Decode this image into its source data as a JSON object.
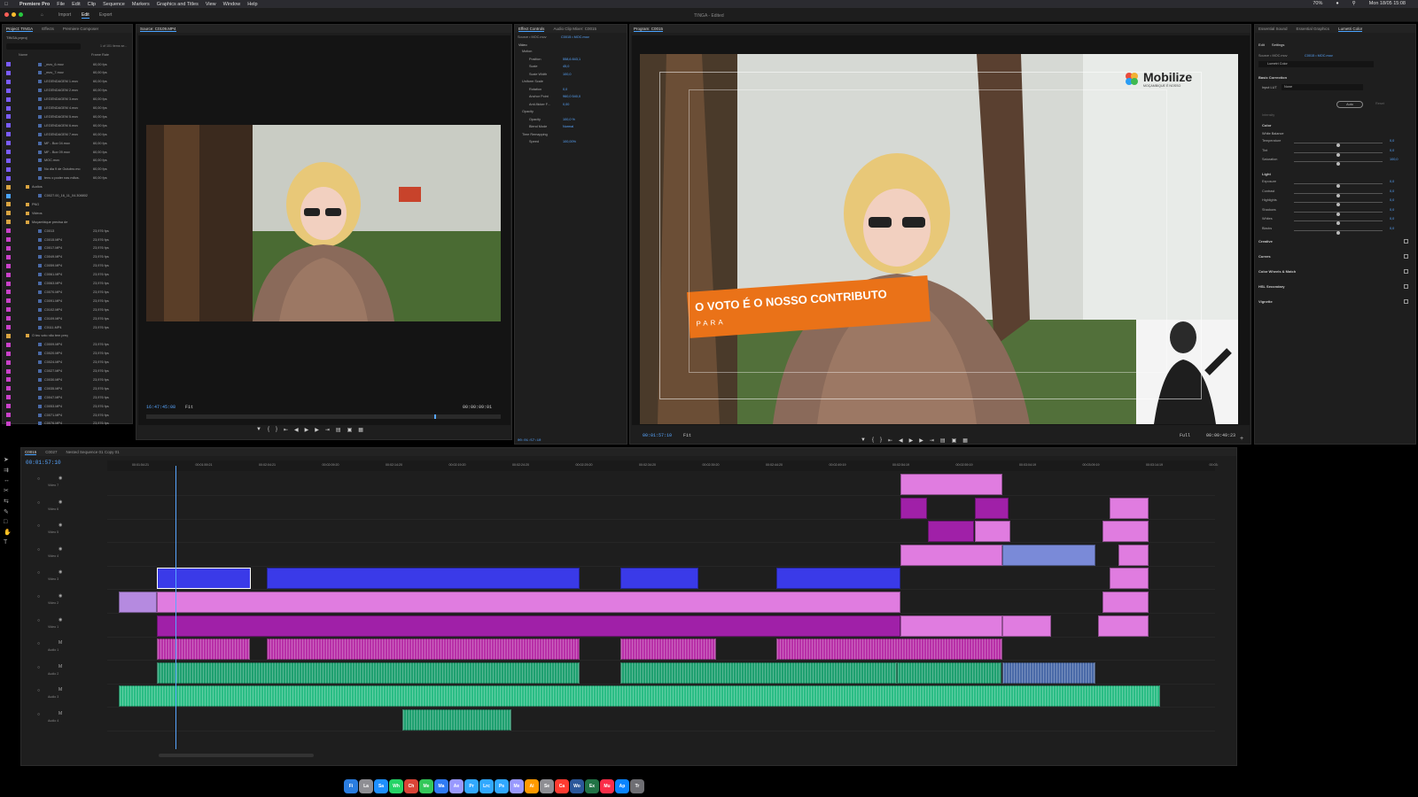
{
  "menubar": {
    "app_name": "Premiere Pro",
    "items": [
      "File",
      "Edit",
      "Clip",
      "Sequence",
      "Markers",
      "Graphics and Titles",
      "View",
      "Window",
      "Help"
    ],
    "battery": "70%",
    "datetime": "Mon 18/05  15:08"
  },
  "workspace": {
    "tabs": [
      "Import",
      "Edit",
      "Export"
    ],
    "active_tab": "Edit",
    "doc_title": "TINGA - Edited"
  },
  "project_panel": {
    "tabs": [
      "Project: TINGA",
      "Effects",
      "Premiere Composer"
    ],
    "project_file": "TINGA.prproj",
    "item_count": "1 of 101 items se...",
    "col_name": "Name",
    "col_fps": "Frame Rate",
    "items": [
      {
        "name": "_mov_6.mov",
        "fps": "60,00 fps",
        "color": "#7a5cff",
        "type": "clip"
      },
      {
        "name": "_mov_7.mov",
        "fps": "60,00 fps",
        "color": "#7a5cff",
        "type": "clip"
      },
      {
        "name": "LEGENDAGEM 1.mov",
        "fps": "60,00 fps",
        "color": "#7a5cff",
        "type": "clip"
      },
      {
        "name": "LEGENDAGEM 2.mov",
        "fps": "60,00 fps",
        "color": "#7a5cff",
        "type": "clip"
      },
      {
        "name": "LEGENDAGEM 3.mov",
        "fps": "60,00 fps",
        "color": "#7a5cff",
        "type": "clip"
      },
      {
        "name": "LEGENDAGEM 4.mov",
        "fps": "60,00 fps",
        "color": "#7a5cff",
        "type": "clip"
      },
      {
        "name": "LEGENDAGEM 5.mov",
        "fps": "60,00 fps",
        "color": "#7a5cff",
        "type": "clip"
      },
      {
        "name": "LEGENDAGEM 6.mov",
        "fps": "60,00 fps",
        "color": "#7a5cff",
        "type": "clip"
      },
      {
        "name": "LEGENDAGEM 7.mov",
        "fps": "60,00 fps",
        "color": "#7a5cff",
        "type": "clip"
      },
      {
        "name": "MF - Box 04.mov",
        "fps": "60,00 fps",
        "color": "#7a5cff",
        "type": "clip"
      },
      {
        "name": "MF - Box 09.mov",
        "fps": "60,00 fps",
        "color": "#7a5cff",
        "type": "clip"
      },
      {
        "name": "MOC.mov",
        "fps": "60,00 fps",
        "color": "#7a5cff",
        "type": "clip"
      },
      {
        "name": "No dia 9 de Outubro.mo",
        "fps": "60,00 fps",
        "color": "#7a5cff",
        "type": "clip"
      },
      {
        "name": "tens o poder nas mãos.",
        "fps": "60,00 fps",
        "color": "#7a5cff",
        "type": "clip"
      },
      {
        "name": "Audios",
        "fps": "",
        "color": "#d9a441",
        "type": "bin"
      },
      {
        "name": "C0027.00_16_11_04.308802",
        "fps": "",
        "color": "#4aa3ff",
        "type": "clip"
      },
      {
        "name": "PNG",
        "fps": "",
        "color": "#d9a441",
        "type": "bin"
      },
      {
        "name": "Videos",
        "fps": "",
        "color": "#d9a441",
        "type": "bin"
      },
      {
        "name": "Moçambique precisa de",
        "fps": "",
        "color": "#d9a441",
        "type": "bin"
      },
      {
        "name": "C0013",
        "fps": "23,976 fps",
        "color": "#c941c9",
        "type": "clip"
      },
      {
        "name": "C0015.MP4",
        "fps": "23,976 fps",
        "color": "#c941c9",
        "type": "clip"
      },
      {
        "name": "C0017.MP4",
        "fps": "23,976 fps",
        "color": "#c941c9",
        "type": "clip"
      },
      {
        "name": "C0049.MP4",
        "fps": "23,976 fps",
        "color": "#c941c9",
        "type": "clip"
      },
      {
        "name": "C0059.MP4",
        "fps": "23,976 fps",
        "color": "#c941c9",
        "type": "clip"
      },
      {
        "name": "C0061.MP4",
        "fps": "23,976 fps",
        "color": "#c941c9",
        "type": "clip"
      },
      {
        "name": "C0063.MP4",
        "fps": "23,976 fps",
        "color": "#c941c9",
        "type": "clip"
      },
      {
        "name": "C0070.MP4",
        "fps": "23,976 fps",
        "color": "#c941c9",
        "type": "clip"
      },
      {
        "name": "C0091.MP4",
        "fps": "23,976 fps",
        "color": "#c941c9",
        "type": "clip"
      },
      {
        "name": "C0102.MP4",
        "fps": "23,976 fps",
        "color": "#c941c9",
        "type": "clip"
      },
      {
        "name": "C0109.MP4",
        "fps": "23,976 fps",
        "color": "#c941c9",
        "type": "clip"
      },
      {
        "name": "C0111.MP4",
        "fps": "23,976 fps",
        "color": "#c941c9",
        "type": "clip"
      },
      {
        "name": "O teu voto não tem preç",
        "fps": "",
        "color": "#d9a441",
        "type": "bin"
      },
      {
        "name": "C0009.MP4",
        "fps": "23,976 fps",
        "color": "#c941c9",
        "type": "clip"
      },
      {
        "name": "C0020.MP4",
        "fps": "23,976 fps",
        "color": "#c941c9",
        "type": "clip"
      },
      {
        "name": "C0024.MP4",
        "fps": "23,976 fps",
        "color": "#c941c9",
        "type": "clip"
      },
      {
        "name": "C0027.MP4",
        "fps": "23,976 fps",
        "color": "#c941c9",
        "type": "clip"
      },
      {
        "name": "C0030.MP4",
        "fps": "23,976 fps",
        "color": "#c941c9",
        "type": "clip"
      },
      {
        "name": "C0035.MP4",
        "fps": "23,976 fps",
        "color": "#c941c9",
        "type": "clip"
      },
      {
        "name": "C0047.MP4",
        "fps": "23,976 fps",
        "color": "#c941c9",
        "type": "clip"
      },
      {
        "name": "C0053.MP4",
        "fps": "23,976 fps",
        "color": "#c941c9",
        "type": "clip"
      },
      {
        "name": "C0071.MP4",
        "fps": "23,976 fps",
        "color": "#c941c9",
        "type": "clip"
      },
      {
        "name": "C0076.MP4",
        "fps": "23,976 fps",
        "color": "#c941c9",
        "type": "clip"
      }
    ]
  },
  "source_monitor": {
    "tab": "Source: C0109.MP4",
    "timecode": "16:47:45:08",
    "fit": "Fit",
    "duration": "00:00:09:01"
  },
  "effect_controls": {
    "tabs": [
      "Effect Controls",
      "Audio Clip Mixer: C0015"
    ],
    "source": "Source • MOC.mov",
    "seq": "C0015 • MOC.mov",
    "section_video": "Video",
    "rows": [
      {
        "label": "Motion",
        "value": ""
      },
      {
        "label": "Position",
        "value": "558,6   843,1"
      },
      {
        "label": "Scale",
        "value": "45,0"
      },
      {
        "label": "Scale Width",
        "value": "100,0"
      },
      {
        "label": "Uniform Scale",
        "value": ""
      },
      {
        "label": "Rotation",
        "value": "0,0"
      },
      {
        "label": "Anchor Point",
        "value": "960,0   540,0"
      },
      {
        "label": "Anti-flicker F...",
        "value": "0,00"
      },
      {
        "label": "Opacity",
        "value": ""
      },
      {
        "label": "Opacity",
        "value": "100,0 %"
      },
      {
        "label": "Blend Mode",
        "value": "Normal"
      },
      {
        "label": "Time Remapping",
        "value": ""
      },
      {
        "label": "Speed",
        "value": "100,00%"
      }
    ],
    "timecode": "00:01:57:10"
  },
  "program_monitor": {
    "tab": "Program: C0015",
    "logo_text": "Mobilize",
    "logo_sub": "MOÇAMBIQUE É NOSSO",
    "lower_third_main": "O VOTO É O NOSSO CONTRIBUTO",
    "lower_third_sub": "PARA",
    "timecode": "00:01:57:10",
    "fit": "Fit",
    "full": "Full",
    "duration": "00:00:49:23"
  },
  "lumetri": {
    "tabs": [
      "Essential Sound",
      "Essential Graphics",
      "Lumetri Color"
    ],
    "subtabs": [
      "Edit",
      "Settings"
    ],
    "source": "Source • MOC.mov",
    "seq": "C0015 • MOC.mov",
    "effect": "Lumetri Color",
    "basic": "Basic Correction",
    "input_lut_label": "Input LUT",
    "input_lut": "None",
    "auto": "Auto",
    "reset": "Reset",
    "intensity": "Intensity",
    "color_label": "Color",
    "white_balance": "White Balance",
    "color_rows": [
      {
        "label": "Temperature",
        "value": "0,0",
        "pos": 0.5
      },
      {
        "label": "Tint",
        "value": "0,0",
        "pos": 0.5
      },
      {
        "label": "Saturation",
        "value": "100,0",
        "pos": 0.5
      }
    ],
    "light_label": "Light",
    "light_rows": [
      {
        "label": "Exposure",
        "value": "0,0",
        "pos": 0.5
      },
      {
        "label": "Contrast",
        "value": "0,0",
        "pos": 0.5
      },
      {
        "label": "Highlights",
        "value": "0,0",
        "pos": 0.5
      },
      {
        "label": "Shadows",
        "value": "0,0",
        "pos": 0.5
      },
      {
        "label": "Whites",
        "value": "0,0",
        "pos": 0.5
      },
      {
        "label": "Blacks",
        "value": "0,0",
        "pos": 0.5
      }
    ],
    "sections": [
      "Creative",
      "Curves",
      "Color Wheels & Match",
      "HSL Secondary",
      "Vignette"
    ]
  },
  "timeline": {
    "tabs": [
      "C0015",
      "C0027",
      "Nested Sequence 01 Copy 01"
    ],
    "timecode": "00:01:57:10",
    "ruler": [
      "00:01:54:21",
      "00:01:59:21",
      "00:02:04:21",
      "00:02:09:20",
      "00:02:14:20",
      "00:02:19:20",
      "00:02:24:20",
      "00:02:29:20",
      "00:02:34:20",
      "00:02:39:20",
      "00:02:44:20",
      "00:02:49:19",
      "00:02:54:19",
      "00:02:59:19",
      "00:03:04:19",
      "00:03:09:19",
      "00:03:14:19",
      "00:03:"
    ],
    "tracks": [
      "Video 7",
      "Video 6",
      "Video 5",
      "Video 4",
      "Video 3",
      "Video 2",
      "Video 1",
      "Audio 1",
      "Audio 2",
      "Audio 3",
      "Audio 4"
    ]
  },
  "dock_apps": [
    "Finder",
    "Launchpad",
    "Safari",
    "WhatsApp",
    "Chrome",
    "Messages",
    "Mail",
    "Ae",
    "Pr",
    "Lrc",
    "Ps",
    "Me",
    "Ai",
    "Settings",
    "Calendar",
    "Word",
    "Excel",
    "Music",
    "App Store",
    "Trash"
  ]
}
